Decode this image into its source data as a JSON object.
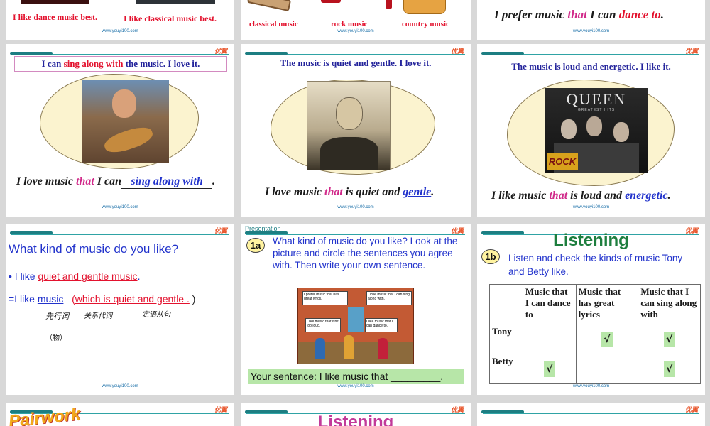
{
  "footer_url": "www.youyi100.com",
  "brand": "优翼",
  "row1": {
    "s1": {
      "a": "I like dance music best.",
      "b": "I like classical music best."
    },
    "s2": {
      "a": "classical music",
      "b": "rock music",
      "c": "country music"
    },
    "s3": {
      "pre": "I prefer music ",
      "that": "that",
      "mid": " I can ",
      "verb": "dance to",
      "post": "."
    }
  },
  "row2": {
    "s1": {
      "box_pre": "I can ",
      "box_mid": "sing along with",
      "box_post": " the music. I love it.",
      "sent_pre": "I love music ",
      "that": "that",
      "sent_mid": " I can",
      "blank": "sing along with",
      "sent_post": "."
    },
    "s2": {
      "title": "The music is quiet and gentle.  I love it.",
      "sent_pre": "I love music ",
      "that": "that",
      "sent_mid": " is quiet and ",
      "adj": "gentle",
      "sent_post": "."
    },
    "s3": {
      "title": "The music is loud and energetic. I like it.",
      "album_title": "QUEEN",
      "album_sub": "GREATEST HITS",
      "album_sticker": "ROCK",
      "sent_pre": "I like music ",
      "that": "that",
      "sent_mid": " is loud and ",
      "adj": "energetic",
      "sent_post": "."
    }
  },
  "row3": {
    "s1": {
      "title": "What kind of music do you like?",
      "bullet_pre": "• I like ",
      "bullet_u": "quiet and gentle music",
      "bullet_post": ".",
      "eq_pre": "=I  like  ",
      "eq_noun": "music",
      "eq_paren": "(",
      "eq_which": "which",
      "eq_rest": "  is quiet and gentle .",
      "eq_close": " )",
      "ann1": "先行词",
      "ann1b": "（物）",
      "ann2": "关系代词",
      "ann3": "定语从句"
    },
    "s2": {
      "label": "Presentation",
      "badge": "1a",
      "instruction": "What kind of music do you like? Look at the picture and circle the sentences you agree with. Then write your own sentence.",
      "bubble1": "I prefer music that has great lyrics.",
      "bubble2": "I love music that I can sing along with.",
      "bubble3": "I like music that isn't too loud.",
      "bubble4": "I like music that I can dance to.",
      "sentence_pre": "Your sentence: I like music that ",
      "sentence_blank": "_________",
      "sentence_post": "."
    },
    "s3": {
      "title": "Listening",
      "badge": "1b",
      "instruction": "Listen and check the kinds of music Tony and Betty like.",
      "columns": [
        "Music that I can dance to",
        "Music that has great lyrics",
        "Music that I can sing along with"
      ],
      "rows": [
        {
          "name": "Tony",
          "checks": [
            "",
            "√",
            "√"
          ]
        },
        {
          "name": "Betty",
          "checks": [
            "√",
            "",
            "√"
          ]
        }
      ]
    }
  },
  "row4": {
    "s1": {
      "title": "Pairwork"
    },
    "s2": {
      "title": "Listening"
    }
  }
}
